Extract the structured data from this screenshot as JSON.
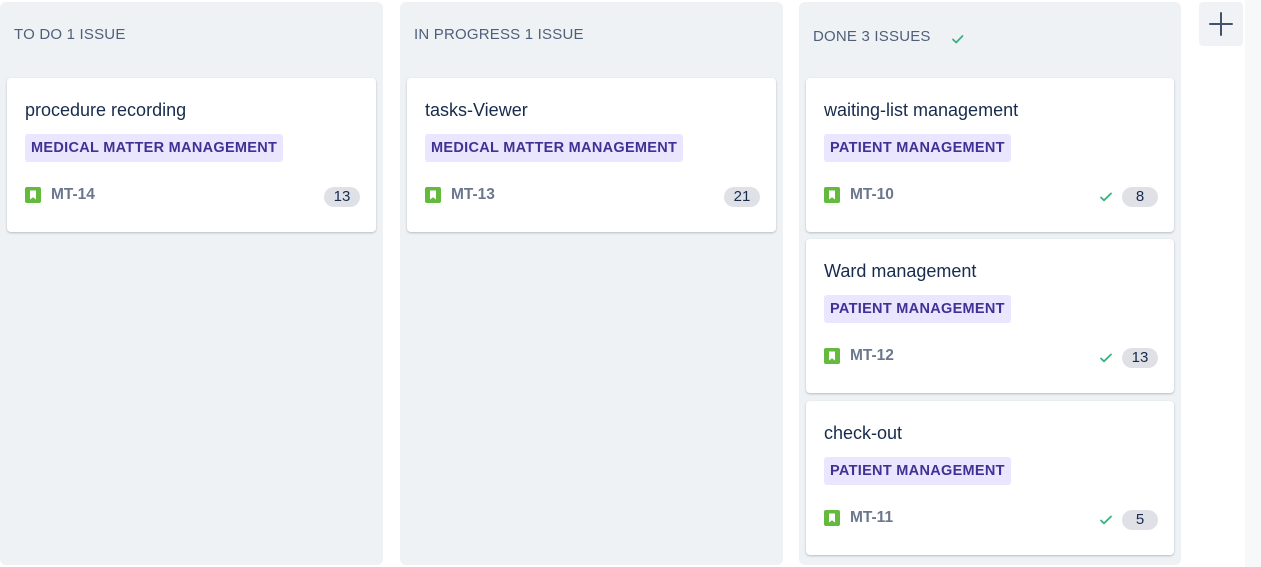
{
  "colors": {
    "column_bg": "#eef2f4",
    "epic_bg": "#eae6ff",
    "epic_text": "#403294",
    "story_icon": "#63ba3c",
    "done_check": "#36b37e"
  },
  "icons": {
    "story": "bookmark-icon",
    "done": "check-icon",
    "add": "plus-icon"
  },
  "columns": [
    {
      "header": "TO DO 1 ISSUE",
      "done": false,
      "cards": [
        {
          "title": "procedure recording",
          "epic": "MEDICAL MATTER MANAGEMENT",
          "key": "MT-14",
          "estimate": "13",
          "done": false
        }
      ]
    },
    {
      "header": "IN PROGRESS 1 ISSUE",
      "done": false,
      "cards": [
        {
          "title": "tasks-Viewer",
          "epic": "MEDICAL MATTER MANAGEMENT",
          "key": "MT-13",
          "estimate": "21",
          "done": false
        }
      ]
    },
    {
      "header": "DONE 3 ISSUES",
      "done": true,
      "cards": [
        {
          "title": "waiting-list management",
          "epic": "PATIENT MANAGEMENT",
          "key": "MT-10",
          "estimate": "8",
          "done": true
        },
        {
          "title": "Ward management",
          "epic": "PATIENT MANAGEMENT",
          "key": "MT-12",
          "estimate": "13",
          "done": true
        },
        {
          "title": "check-out",
          "epic": "PATIENT MANAGEMENT",
          "key": "MT-11",
          "estimate": "5",
          "done": true
        }
      ]
    }
  ]
}
